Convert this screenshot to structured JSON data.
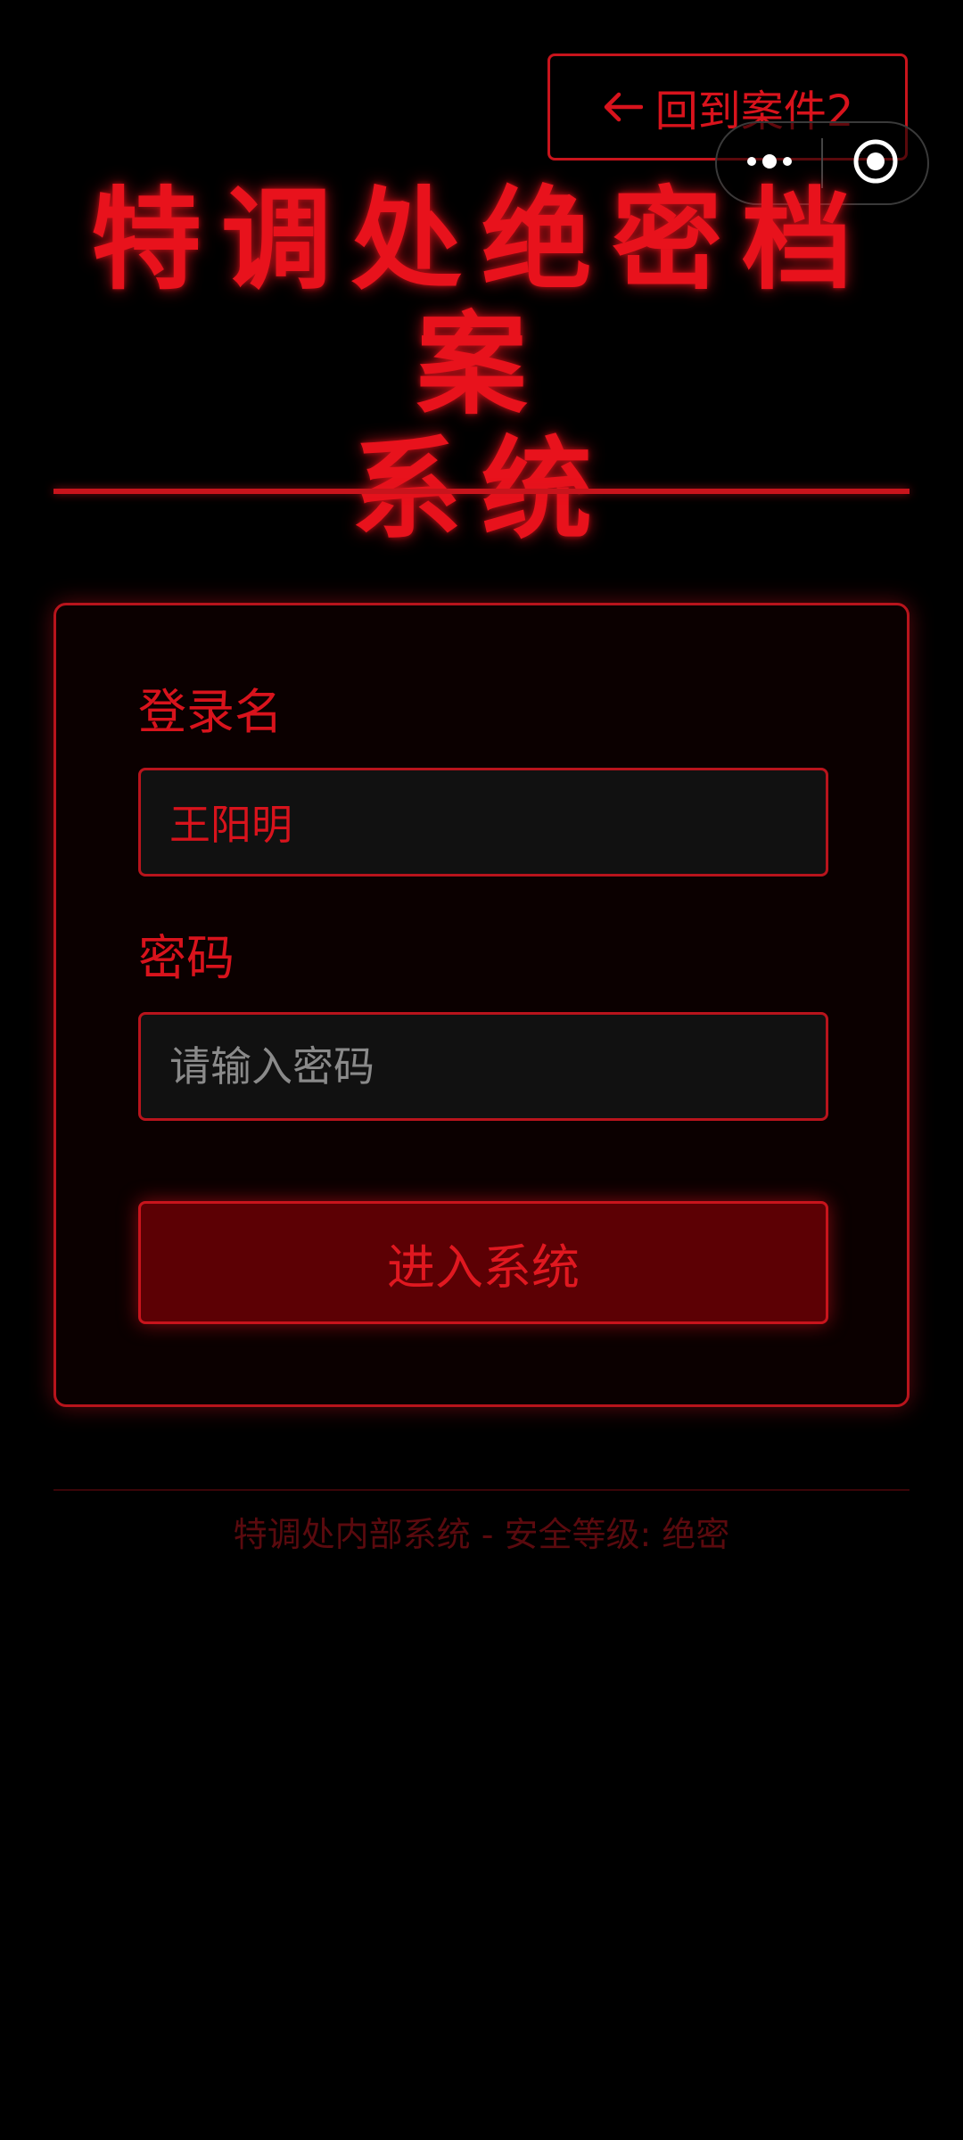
{
  "header": {
    "back_label": "回到案件2",
    "title_line1": "特调处绝密档案",
    "title_line2": "系统"
  },
  "login": {
    "username_label": "登录名",
    "username_value": "王阳明",
    "password_label": "密码",
    "password_placeholder": "请输入密码",
    "submit_label": "进入系统"
  },
  "footer": {
    "text": "特调处内部系统 - 安全等级: 绝密"
  },
  "icons": {
    "back": "arrow-left-icon",
    "capsule_more": "more-dots-icon",
    "capsule_close": "target-close-icon"
  },
  "colors": {
    "accent": "#d8131c",
    "background": "#000000",
    "button_fill": "#5c0004",
    "input_fill": "#111111"
  }
}
